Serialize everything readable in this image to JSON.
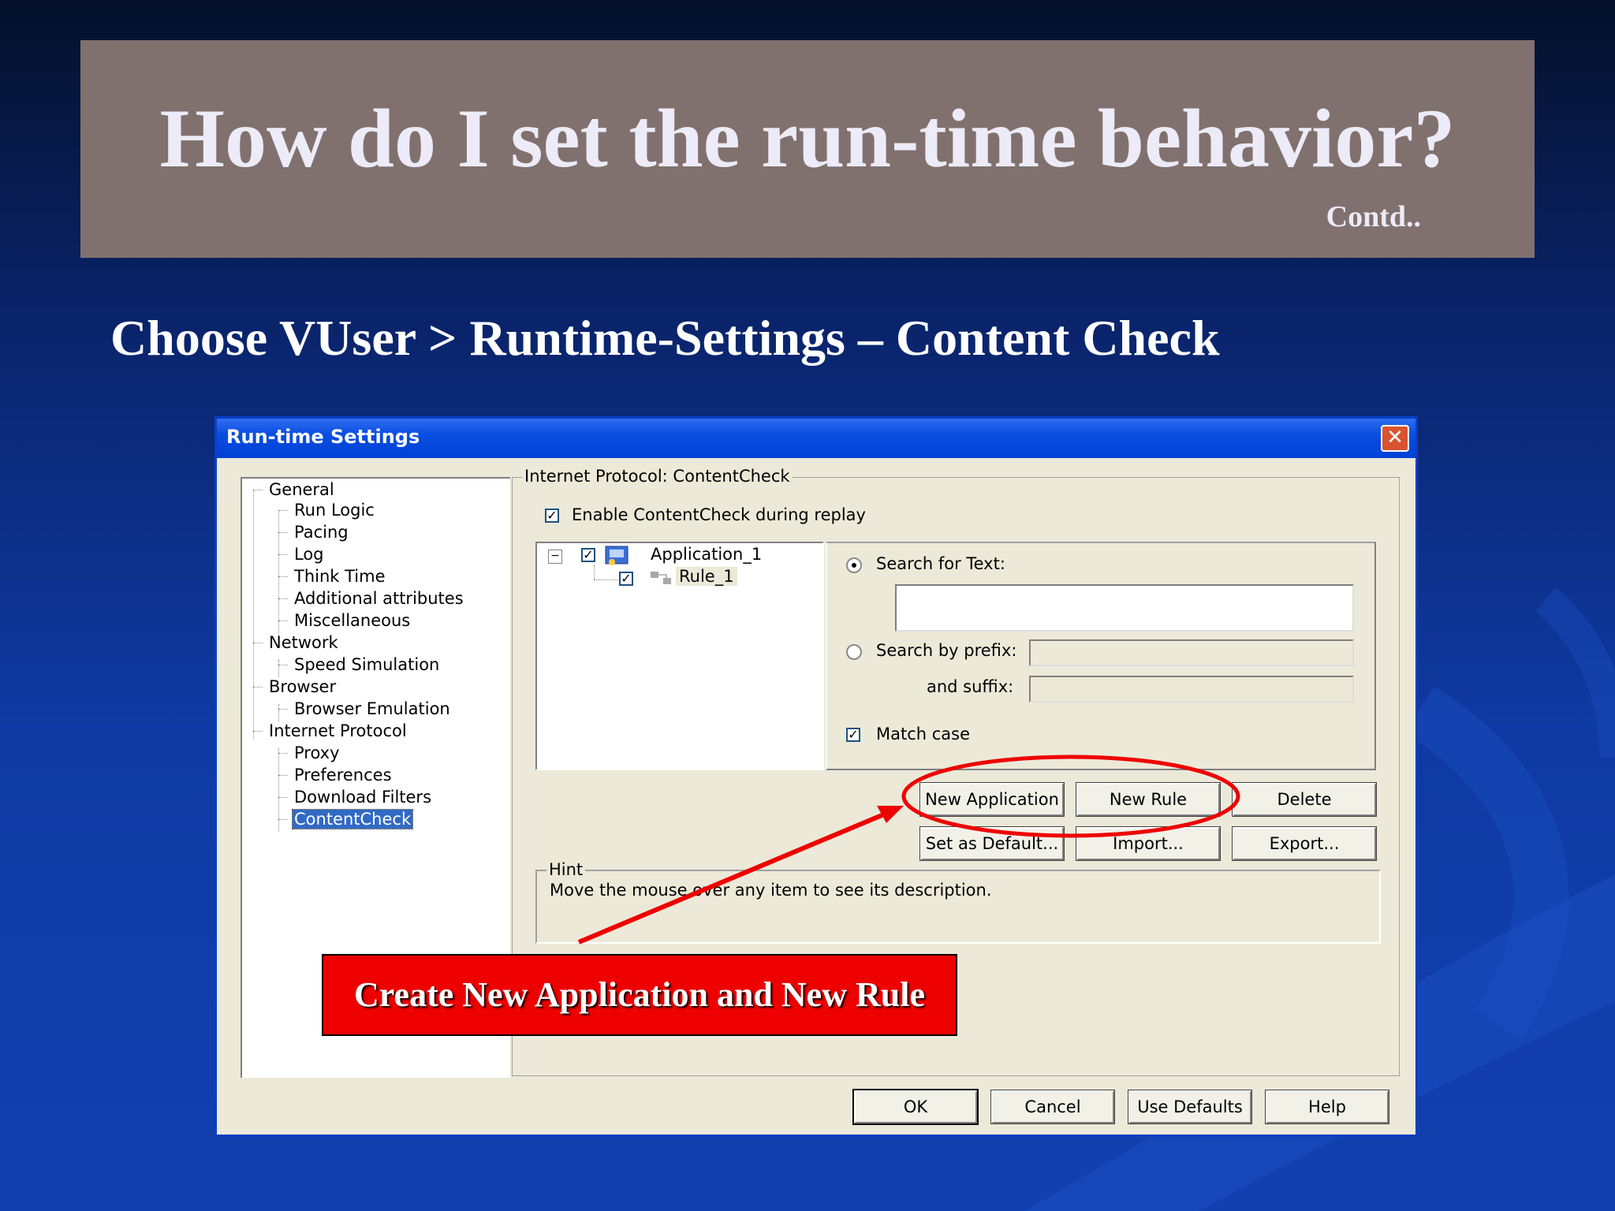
{
  "slide": {
    "title": "How do I set the run-time behavior?",
    "contd": "Contd..",
    "subtitle": "Choose VUser > Runtime-Settings – Content Check",
    "callout": "Create New Application and New Rule"
  },
  "dialog": {
    "title": "Run-time Settings",
    "close_glyph": "✕",
    "tree": {
      "general": "General",
      "run_logic": "Run Logic",
      "pacing": "Pacing",
      "log": "Log",
      "think_time": "Think Time",
      "additional_attributes": "Additional attributes",
      "miscellaneous": "Miscellaneous",
      "network": "Network",
      "speed_simulation": "Speed Simulation",
      "browser": "Browser",
      "browser_emulation": "Browser Emulation",
      "internet_protocol": "Internet Protocol",
      "proxy": "Proxy",
      "preferences": "Preferences",
      "download_filters": "Download Filters",
      "contentcheck": "ContentCheck"
    },
    "group_title": "Internet Protocol: ContentCheck",
    "enable_label": "Enable ContentCheck during replay",
    "enable_checked": true,
    "app_tree": {
      "collapse_glyph": "−",
      "application": "Application_1",
      "rule": "Rule_1"
    },
    "search_text_label": "Search for Text:",
    "search_text_value": "",
    "search_prefix_label": "Search by prefix:",
    "suffix_label": "and suffix:",
    "match_case_label": "Match case",
    "match_case_checked": true,
    "buttons": {
      "new_application": "New Application",
      "new_rule": "New Rule",
      "delete": "Delete",
      "set_as_default": "Set as Default...",
      "import": "Import...",
      "export": "Export...",
      "ok": "OK",
      "cancel": "Cancel",
      "use_defaults": "Use Defaults",
      "help": "Help"
    },
    "hint_title": "Hint",
    "hint_text": "Move the mouse over any item to see its description.",
    "check_glyph": "✓"
  },
  "colors": {
    "title_band": "#81716e",
    "annotation_red": "#ee0000",
    "selection": "#316ac5",
    "dialog_bg": "#ece9d8"
  }
}
